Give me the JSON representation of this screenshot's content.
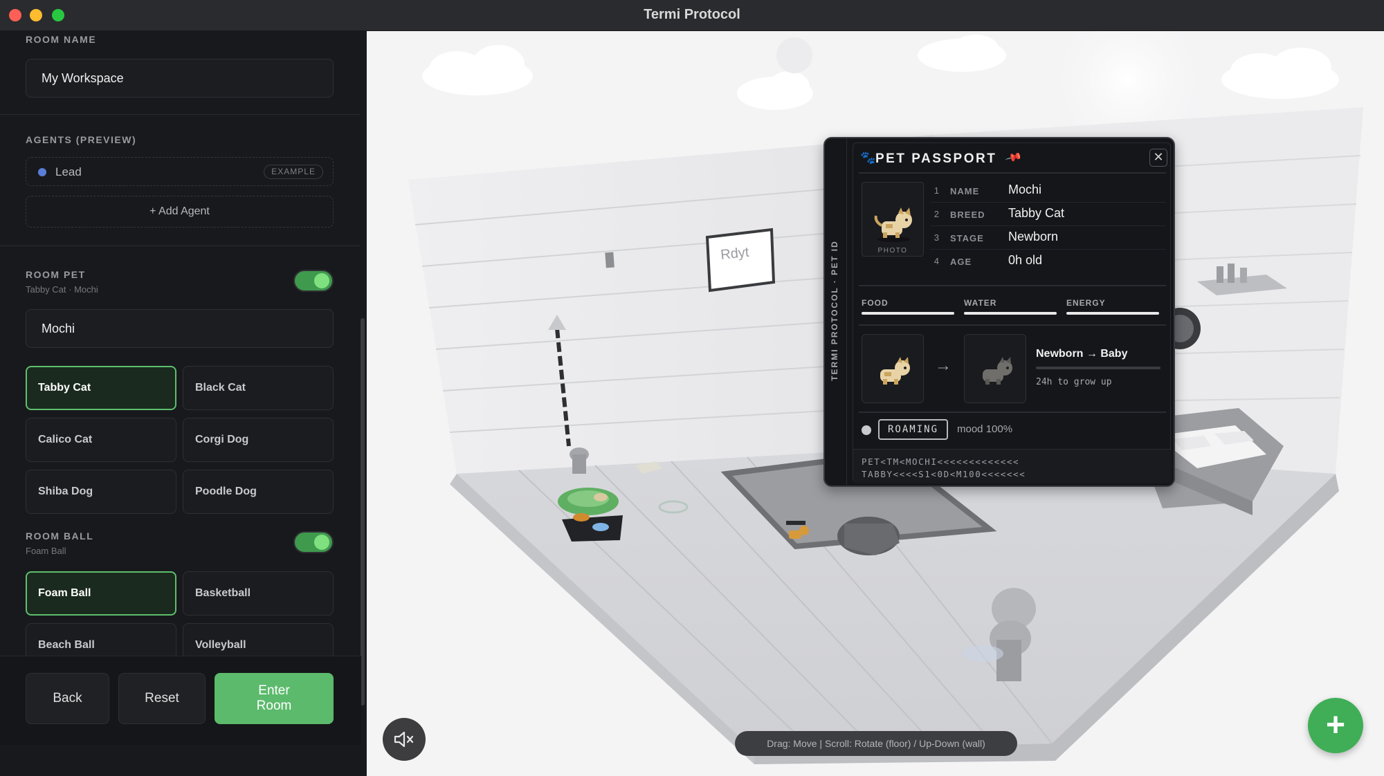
{
  "window": {
    "title": "Termi Protocol"
  },
  "sidebar": {
    "room_name": {
      "label": "ROOM NAME",
      "value": "My Workspace"
    },
    "agents": {
      "label": "AGENTS (PREVIEW)",
      "items": [
        {
          "name": "Lead",
          "badge": "EXAMPLE",
          "dot_color": "#5a7ed8"
        }
      ],
      "add_label": "+ Add Agent"
    },
    "room_pet": {
      "label": "ROOM PET",
      "subtitle": "Tabby Cat · Mochi",
      "enabled": true,
      "name_value": "Mochi",
      "options": [
        "Tabby Cat",
        "Black Cat",
        "Calico Cat",
        "Corgi Dog",
        "Shiba Dog",
        "Poodle Dog"
      ],
      "selected": "Tabby Cat"
    },
    "room_ball": {
      "label": "ROOM BALL",
      "subtitle": "Foam Ball",
      "enabled": true,
      "options": [
        "Foam Ball",
        "Basketball",
        "Beach Ball",
        "Volleyball"
      ],
      "selected": "Foam Ball"
    },
    "footer": {
      "back": "Back",
      "reset": "Reset",
      "enter": "Enter Room"
    }
  },
  "scene": {
    "hint": "Drag: Move | Scroll: Rotate (floor) / Up-Down (wall)",
    "fab_icon": "plus-icon",
    "mute_icon": "speaker-muted-icon",
    "whiteboard_text": "Rdyt"
  },
  "passport": {
    "spine": "TERMI PROTOCOL · PET ID",
    "title": "PET PASSPORT",
    "close_icon": "close-icon",
    "pin_icon": "pin-icon",
    "photo_label": "PHOTO",
    "fields": [
      {
        "num": "1",
        "key": "NAME",
        "value": "Mochi"
      },
      {
        "num": "2",
        "key": "BREED",
        "value": "Tabby Cat"
      },
      {
        "num": "3",
        "key": "STAGE",
        "value": "Newborn"
      },
      {
        "num": "4",
        "key": "AGE",
        "value": "0h old"
      }
    ],
    "stats": [
      {
        "label": "FOOD",
        "fraction": 1.0
      },
      {
        "label": "WATER",
        "fraction": 1.0
      },
      {
        "label": "ENERGY",
        "fraction": 1.0
      }
    ],
    "evolution": {
      "title": "Newborn → Baby",
      "progress": 0.0,
      "subtitle": "24h to grow up"
    },
    "status": {
      "state": "ROAMING",
      "mood": "mood 100%"
    },
    "mrz": [
      "PET<TM<MOCHI<<<<<<<<<<<<<",
      "TABBY<<<<S1<0D<M100<<<<<<<"
    ],
    "colors": {
      "accent": "#5cba6c",
      "panel": "#15161a"
    }
  }
}
